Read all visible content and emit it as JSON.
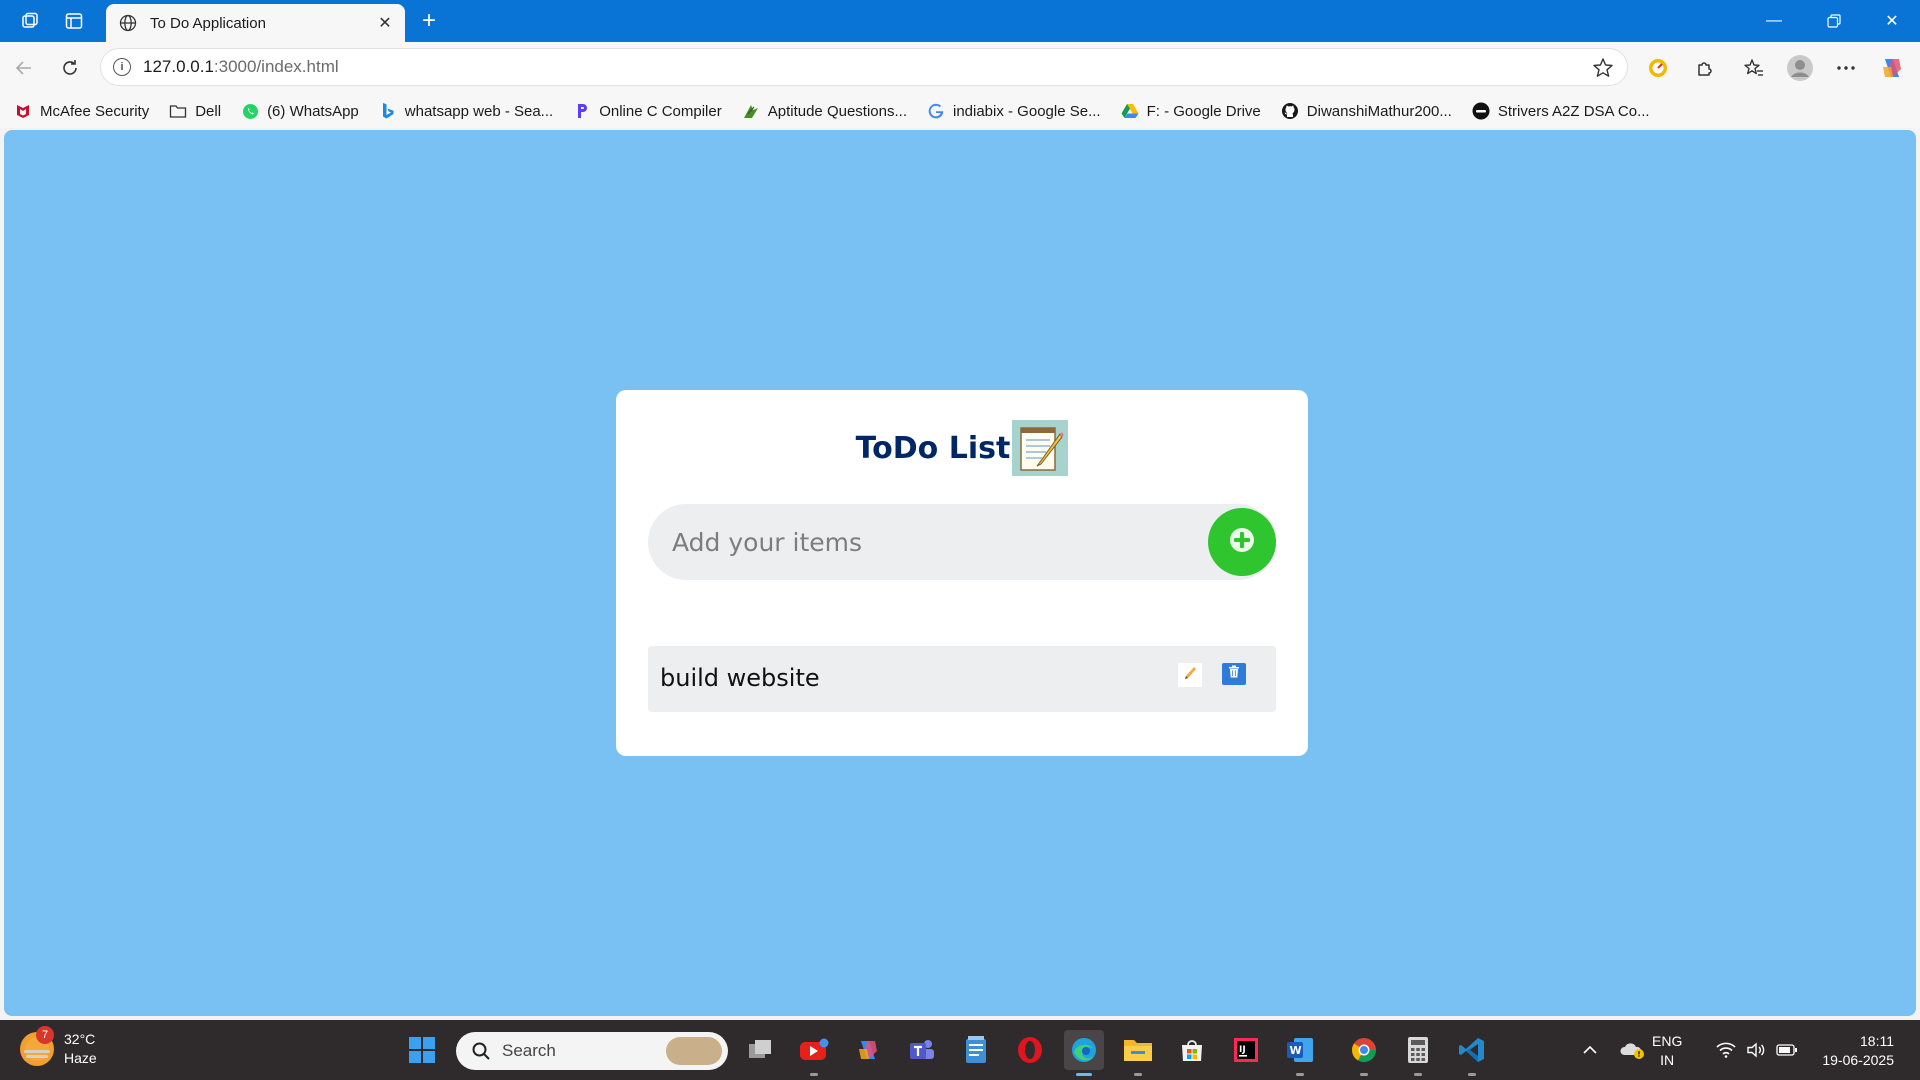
{
  "browser": {
    "tab_title": "To Do Application",
    "url_host": "127.0.0.1",
    "url_path": ":3000/index.html",
    "accent_color": "#0a74d6"
  },
  "bookmarks": [
    {
      "label": "McAfee Security",
      "icon": "mcafee-icon"
    },
    {
      "label": "Dell",
      "icon": "folder-icon"
    },
    {
      "label": "(6) WhatsApp",
      "icon": "whatsapp-icon"
    },
    {
      "label": "whatsapp web - Sea...",
      "icon": "bing-icon"
    },
    {
      "label": "Online C Compiler",
      "icon": "programiz-icon"
    },
    {
      "label": "Aptitude Questions...",
      "icon": "indiabix-icon"
    },
    {
      "label": "indiabix - Google Se...",
      "icon": "google-icon"
    },
    {
      "label": "F: - Google Drive",
      "icon": "google-drive-icon"
    },
    {
      "label": "DiwanshiMathur200...",
      "icon": "github-icon"
    },
    {
      "label": "Strivers A2Z DSA Co...",
      "icon": "tuf-icon"
    }
  ],
  "app": {
    "title": "ToDo List",
    "input_placeholder": "Add your items",
    "input_value": "",
    "background_color": "#7ac1f3",
    "add_button_color": "#2ec52e",
    "items": [
      {
        "text": "build website"
      }
    ]
  },
  "taskbar": {
    "weather_temp": "32°C",
    "weather_desc": "Haze",
    "weather_badge": "7",
    "search_label": "Search",
    "language": "ENG",
    "region": "IN",
    "time": "18:11",
    "date": "19-06-2025"
  }
}
